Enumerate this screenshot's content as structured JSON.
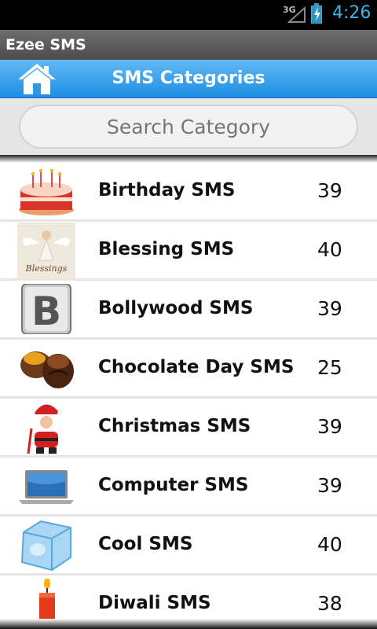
{
  "status_bar": {
    "network": "3G",
    "time": "4:26"
  },
  "app_title": "Ezee SMS",
  "header": {
    "title": "SMS Categories",
    "home_icon": "home-icon"
  },
  "search": {
    "placeholder": "Search Category"
  },
  "categories": [
    {
      "name": "Birthday SMS",
      "count": "39",
      "icon": "birthday-cake-icon"
    },
    {
      "name": "Blessing SMS",
      "count": "40",
      "icon": "blessings-angel-icon"
    },
    {
      "name": "Bollywood SMS",
      "count": "39",
      "icon": "letter-b-icon"
    },
    {
      "name": "Chocolate Day SMS",
      "count": "25",
      "icon": "chocolates-icon"
    },
    {
      "name": "Christmas SMS",
      "count": "39",
      "icon": "santa-claus-icon"
    },
    {
      "name": "Computer SMS",
      "count": "39",
      "icon": "laptop-icon"
    },
    {
      "name": "Cool SMS",
      "count": "40",
      "icon": "ice-cube-icon"
    },
    {
      "name": "Diwali SMS",
      "count": "38",
      "icon": "diwali-candle-icon"
    }
  ],
  "colors": {
    "header_blue": "#1d8ee3",
    "status_accent": "#3bb4e8"
  }
}
